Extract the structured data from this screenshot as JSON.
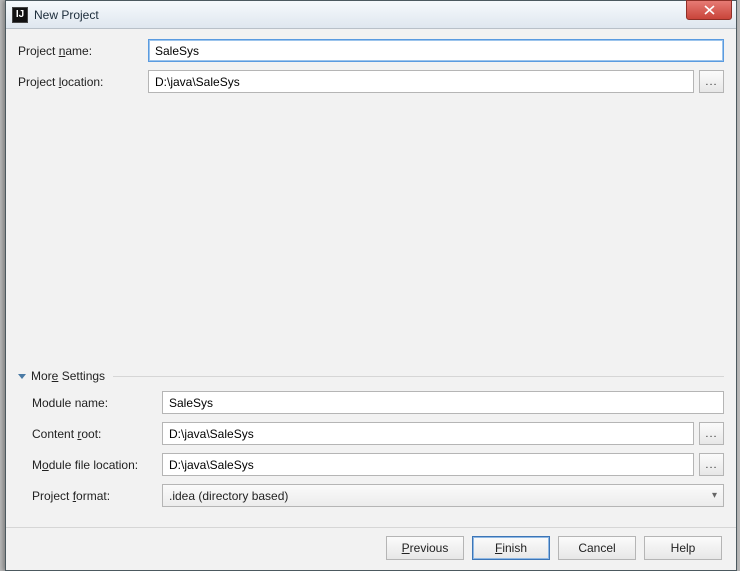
{
  "window": {
    "title": "New Project",
    "icon_letter": "IJ"
  },
  "project": {
    "name_label_pre": "Project ",
    "name_underline": "n",
    "name_label_post": "ame:",
    "name_value": "SaleSys",
    "location_label_pre": "Project ",
    "location_underline": "l",
    "location_label_post": "ocation:",
    "location_value": "D:\\java\\SaleSys",
    "browse_glyph": "..."
  },
  "more_settings": {
    "header_pre": "Mor",
    "header_under": "e",
    "header_post": " Settings",
    "module_name_label": "Module name:",
    "module_name_value": "SaleSys",
    "content_root_pre": "Content ",
    "content_root_under": "r",
    "content_root_post": "oot:",
    "content_root_value": "D:\\java\\SaleSys",
    "module_file_pre": "M",
    "module_file_under": "o",
    "module_file_post": "dule file location:",
    "module_file_value": "D:\\java\\SaleSys",
    "project_format_pre": "Project ",
    "project_format_under": "f",
    "project_format_post": "ormat:",
    "project_format_value": ".idea (directory based)"
  },
  "footer": {
    "previous_pre": "",
    "previous_under": "P",
    "previous_post": "revious",
    "finish_pre": "",
    "finish_under": "F",
    "finish_post": "inish",
    "cancel": "Cancel",
    "help": "Help"
  }
}
